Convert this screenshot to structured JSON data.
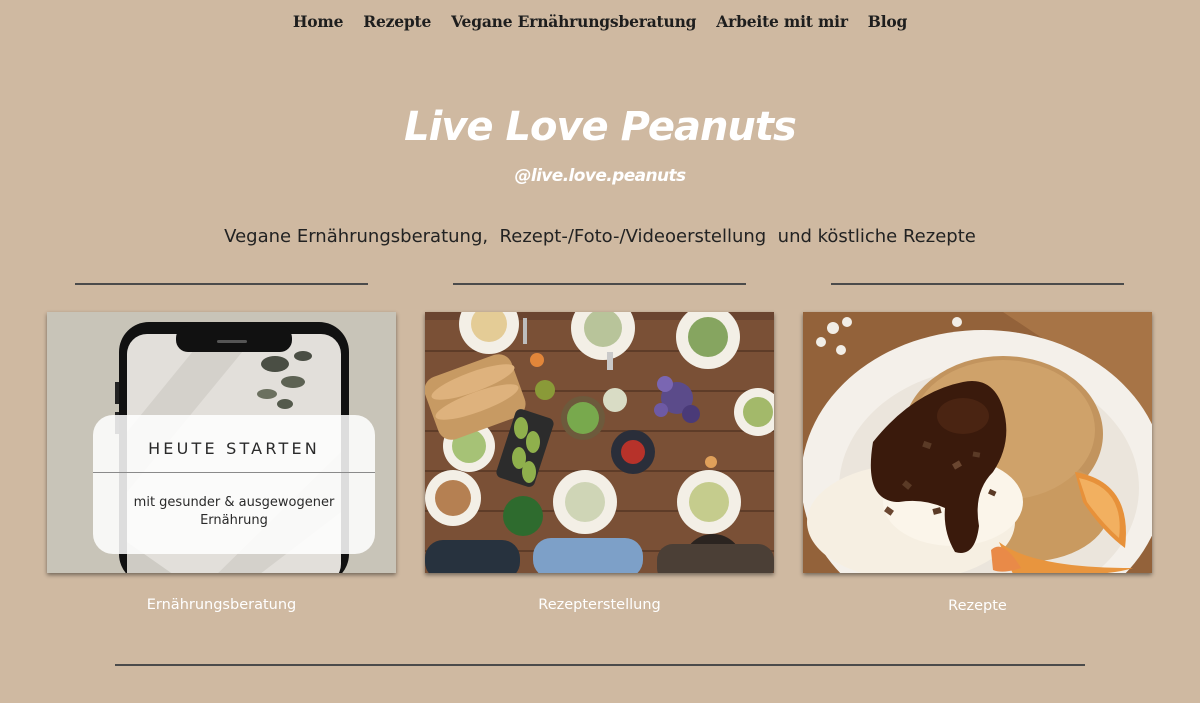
{
  "nav": {
    "items": [
      {
        "label": "Home"
      },
      {
        "label": "Rezepte"
      },
      {
        "label": "Vegane Ernährungsberatung"
      },
      {
        "label": "Arbeite mit mir"
      },
      {
        "label": "Blog"
      }
    ]
  },
  "hero": {
    "title": "Live Love Peanuts",
    "handle": "@live.love.peanuts",
    "tagline": "Vegane Ernährungsberatung,  Rezept-/Foto-/Videoerstellung  und köstliche Rezepte"
  },
  "cards": [
    {
      "caption": "Ernährungsberatung",
      "overlay_title": "HEUTE STARTEN",
      "overlay_subtitle": "mit gesunder & ausgewogener Ernährung"
    },
    {
      "caption": "Rezepterstellung"
    },
    {
      "caption": "Rezepte"
    }
  ],
  "colors": {
    "background": "#cfb9a1",
    "divider": "#4b4b4b",
    "nav_text": "#1e1e1e",
    "hero_text": "#ffffff"
  }
}
